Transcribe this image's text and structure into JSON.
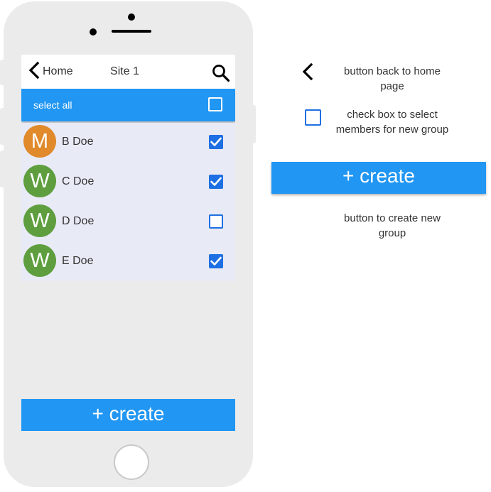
{
  "navbar": {
    "back_label": "Home",
    "title": "Site 1",
    "icons": {
      "back": "chevron-left-icon",
      "search": "search-icon"
    }
  },
  "select_all": {
    "label": "select all",
    "checked": false
  },
  "members": [
    {
      "initial": "M",
      "name": "B Doe",
      "avatar_color": "#e08a2c",
      "checked": true
    },
    {
      "initial": "W",
      "name": "C Doe",
      "avatar_color": "#5e9e3e",
      "checked": true
    },
    {
      "initial": "W",
      "name": "D Doe",
      "avatar_color": "#5e9e3e",
      "checked": false
    },
    {
      "initial": "W",
      "name": "E Doe",
      "avatar_color": "#5e9e3e",
      "checked": true
    }
  ],
  "create_button": {
    "label": "+ create"
  },
  "legend": {
    "back_note": "button back to home page",
    "checkbox_note": "check box to select members for new group",
    "create_label": "+ create",
    "create_note": "button to create new group"
  },
  "colors": {
    "accent": "#2196f3",
    "checkbox": "#1e6fe3",
    "list_background": "#e8eaf6",
    "phone_frame": "#ebebeb"
  }
}
